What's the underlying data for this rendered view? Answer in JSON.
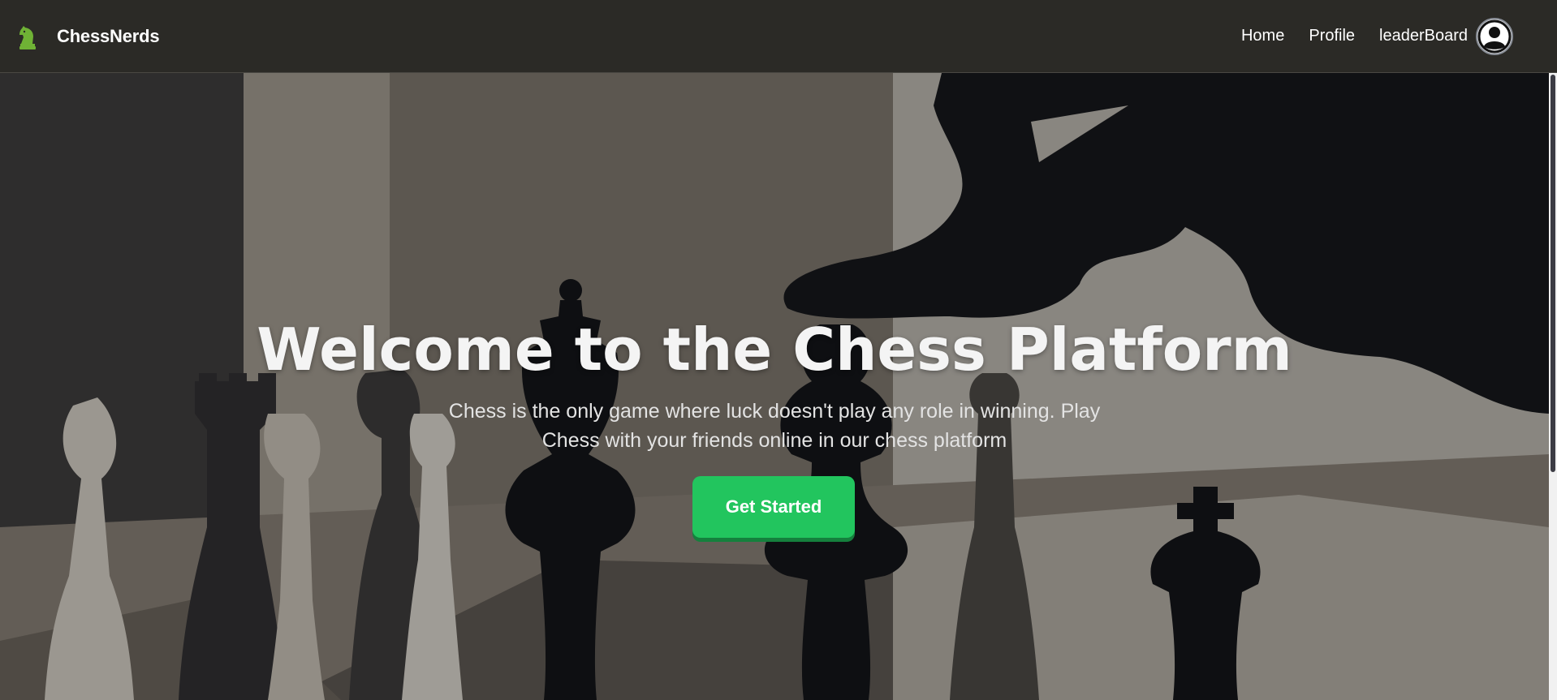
{
  "navbar": {
    "brand": "ChessNerds",
    "logo_icon": "chess-knight-icon",
    "links": [
      {
        "label": "Home"
      },
      {
        "label": "Profile"
      },
      {
        "label": "leaderBoard"
      }
    ],
    "avatar_icon": "user-circle-icon"
  },
  "hero": {
    "title": "Welcome to the Chess Platform",
    "subtitle": "Chess is the only game where luck doesn't play any role in winning. Play Chess with your friends online in our chess platform",
    "cta_label": "Get Started",
    "background": "chess-pieces-illustration"
  },
  "colors": {
    "navbar_bg": "#2b2a26",
    "accent_green": "#22c55e",
    "accent_green_dark": "#15803d",
    "logo_green": "#6fb235",
    "text_white": "#ffffff"
  }
}
